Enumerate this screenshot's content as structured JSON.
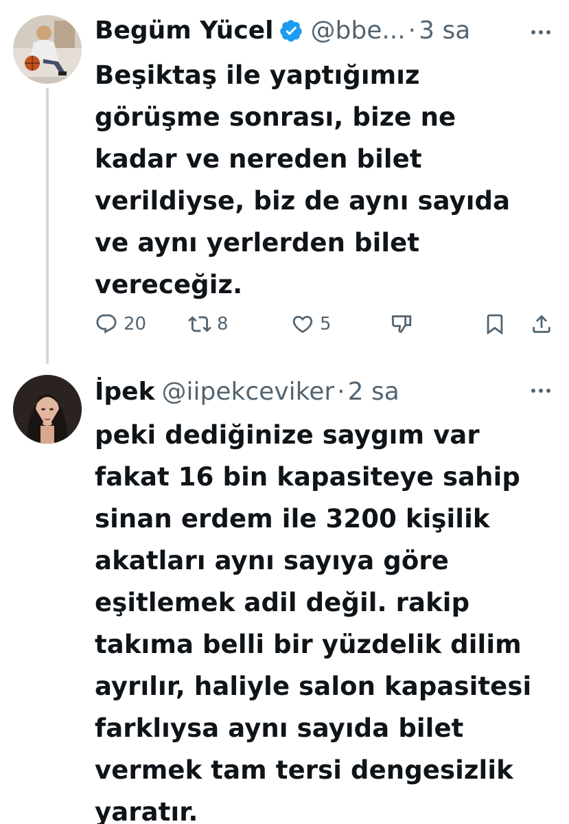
{
  "colors": {
    "text_primary": "#0f1419",
    "text_secondary": "#536471",
    "verified_blue": "#1d9bf0",
    "thread_line": "#cfd9de"
  },
  "tweets": [
    {
      "display_name": "Begüm Yücel",
      "verified": true,
      "handle": "@bbe...",
      "separator": "·",
      "time": "3 sa",
      "text": "Beşiktaş ile yaptığımız\ngörüşme sonrası, bize ne\nkadar ve nereden bilet\nverildiyse, biz de aynı sayıda\nve aynı yerlerden bilet\nvereceğiz.",
      "actions": {
        "reply_icon": "reply-icon",
        "reply_count": "20",
        "retweet_icon": "retweet-icon",
        "retweet_count": "8",
        "like_icon": "heart-icon",
        "like_count": "5",
        "downvote_icon": "thumbs-down-icon",
        "bookmark_icon": "bookmark-icon",
        "share_icon": "share-icon"
      }
    },
    {
      "display_name": "İpek",
      "verified": false,
      "handle": "@iipekceviker",
      "separator": "·",
      "time": "2 sa",
      "text": "peki dediğinize saygım var\nfakat 16 bin kapasiteye sahip\nsinan erdem ile 3200 kişilik\nakatları aynı sayıya göre\neşitlemek adil değil. rakip\ntakıma belli bir yüzdelik dilim\nayrılır, haliyle salon kapasitesi\nfarklıysa aynı sayıda bilet\nvermek tam tersi dengesizlik\nyaratır."
    }
  ]
}
